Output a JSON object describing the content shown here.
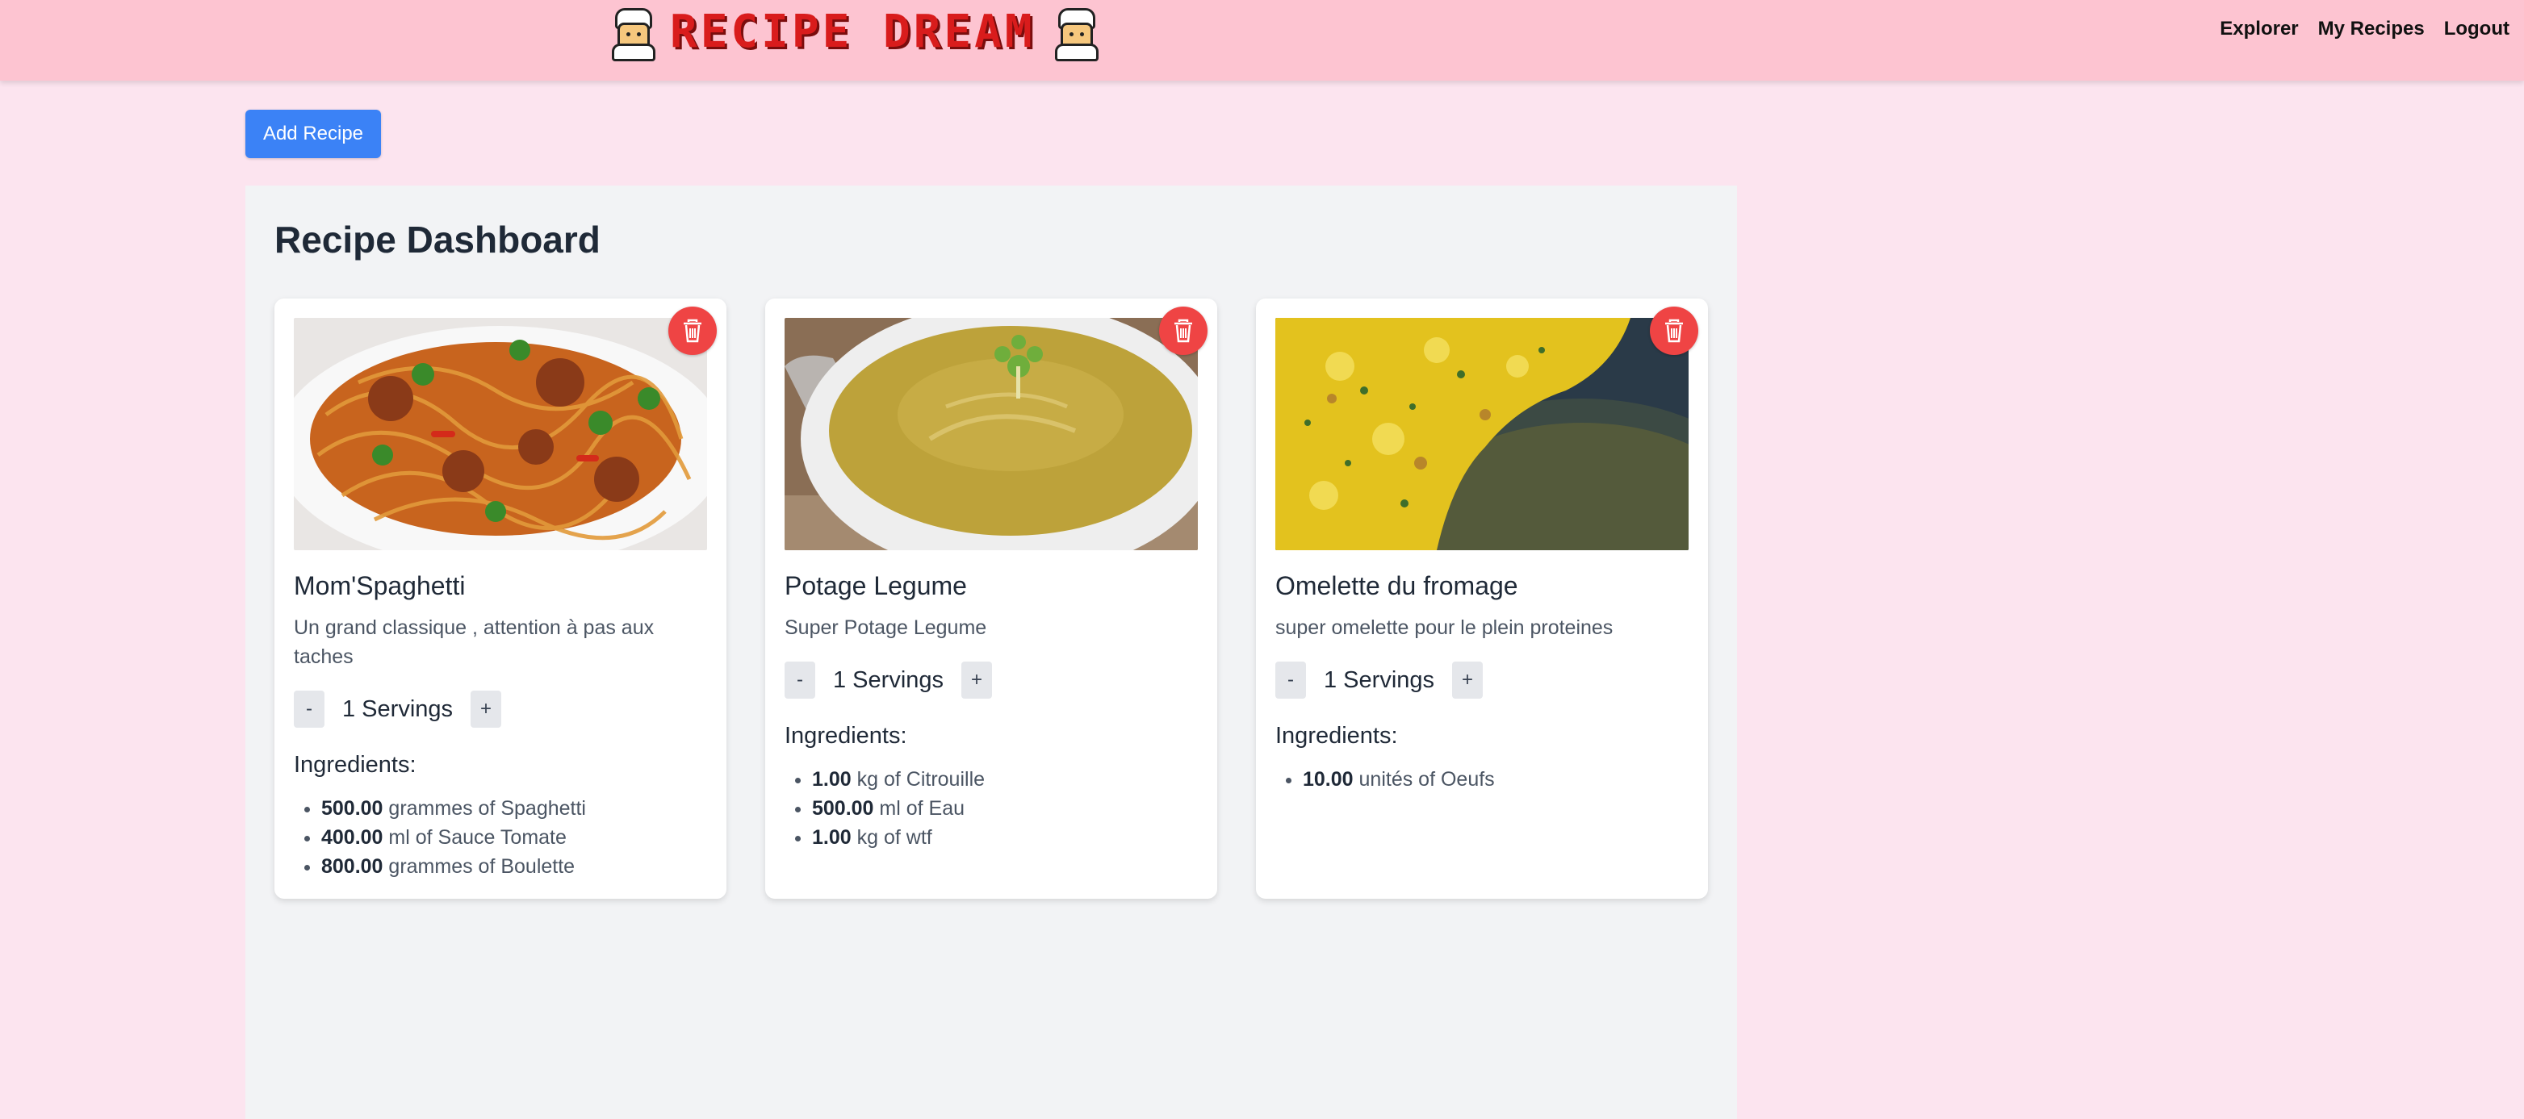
{
  "brand": {
    "title": "RECIPE DREAM"
  },
  "nav": [
    "Explorer",
    "My Recipes",
    "Logout"
  ],
  "add_button": "Add Recipe",
  "dashboard": {
    "title": "Recipe Dashboard"
  },
  "ingredients_label": "Ingredients:",
  "recipes": [
    {
      "title": "Mom'Spaghetti",
      "description": "Un grand classique , attention à pas aux taches",
      "servings": "1 Servings",
      "ingredients": [
        {
          "qty": "500.00",
          "text": "grammes of Spaghetti"
        },
        {
          "qty": "400.00",
          "text": "ml of Sauce Tomate"
        },
        {
          "qty": "800.00",
          "text": "grammes of Boulette"
        }
      ]
    },
    {
      "title": "Potage Legume",
      "description": "Super Potage Legume",
      "servings": "1 Servings",
      "ingredients": [
        {
          "qty": "1.00",
          "text": "kg of Citrouille"
        },
        {
          "qty": "500.00",
          "text": "ml of Eau"
        },
        {
          "qty": "1.00",
          "text": "kg of wtf"
        }
      ]
    },
    {
      "title": "Omelette du fromage",
      "description": "super omelette pour le plein proteines",
      "servings": "1 Servings",
      "ingredients": [
        {
          "qty": "10.00",
          "text": "unités of Oeufs"
        }
      ]
    }
  ],
  "stepper": {
    "minus": "-",
    "plus": "+"
  },
  "colors": {
    "accent": "#3b82f6",
    "danger": "#ef4444",
    "header": "#fdc4d1",
    "brand": "#d91c1c"
  }
}
